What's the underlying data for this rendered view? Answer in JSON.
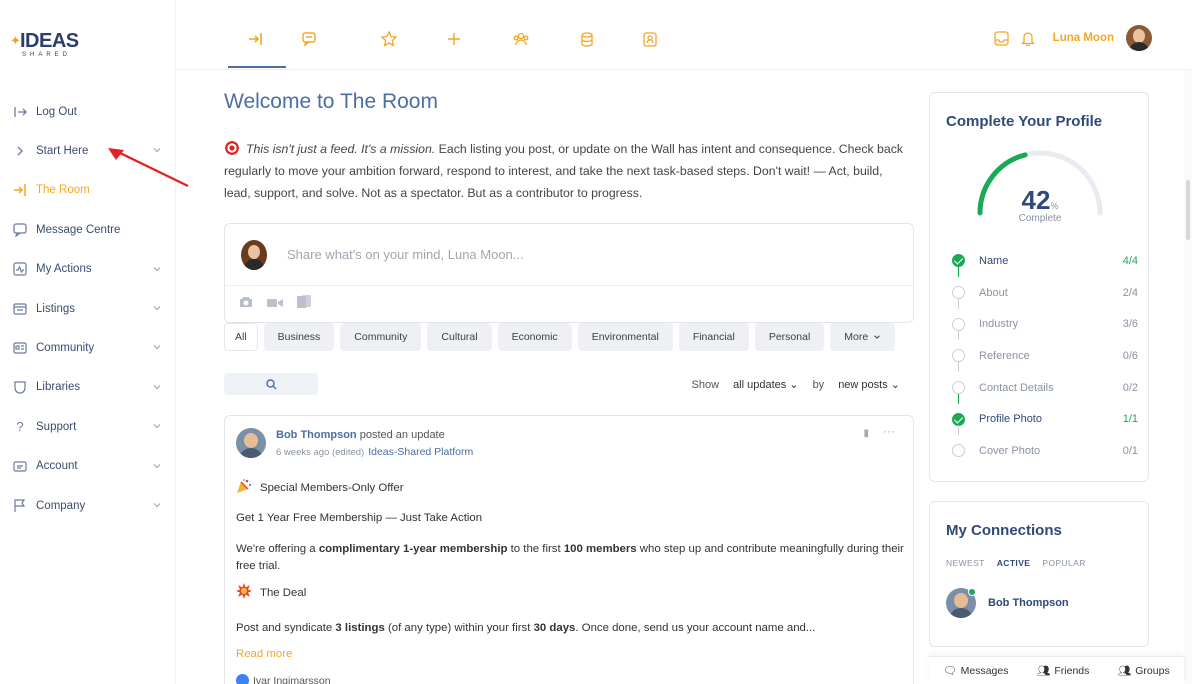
{
  "logo": {
    "text": "IDEAS",
    "sub": "SHARED"
  },
  "sidebar": {
    "items": [
      {
        "label": "Log Out",
        "icon": "logout-icon",
        "chevron": false
      },
      {
        "label": "Start Here",
        "icon": "chevron-right-icon",
        "chevron": true
      },
      {
        "label": "The Room",
        "icon": "enter-icon",
        "chevron": false,
        "active": true
      },
      {
        "label": "Message Centre",
        "icon": "chat-icon",
        "chevron": false
      },
      {
        "label": "My Actions",
        "icon": "activity-icon",
        "chevron": true
      },
      {
        "label": "Listings",
        "icon": "listings-icon",
        "chevron": true
      },
      {
        "label": "Community",
        "icon": "id-card-icon",
        "chevron": true
      },
      {
        "label": "Libraries",
        "icon": "library-icon",
        "chevron": true
      },
      {
        "label": "Support",
        "icon": "question-icon",
        "chevron": true
      },
      {
        "label": "Account",
        "icon": "account-icon",
        "chevron": true
      },
      {
        "label": "Company",
        "icon": "flag-icon",
        "chevron": true
      }
    ]
  },
  "topbar": {
    "icons": [
      "enter-icon",
      "chat-icon",
      "star-icon",
      "plus-icon",
      "community-icon",
      "database-icon",
      "contact-icon"
    ],
    "user_name": "Luna Moon"
  },
  "main": {
    "title": "Welcome to The Room",
    "intro_em": "This isn't just a feed. It's a mission.",
    "intro_rest": " Each listing you post, or update on the Wall has intent and consequence. Check back regularly to move your ambition forward, respond to interest, and take the next task-based steps. Don't wait! — Act, build, lead, support, and solve. Not as a spectator. But as a contributor to progress.",
    "composer_placeholder": "Share what's on your mind, Luna Moon...",
    "filters": [
      "All",
      "Business",
      "Community",
      "Cultural",
      "Economic",
      "Environmental",
      "Financial",
      "Personal",
      "More"
    ],
    "show_label": "Show",
    "show_value": "all updates",
    "by_label": "by",
    "by_value": "new posts"
  },
  "post": {
    "author": "Bob Thompson",
    "action": " posted an update",
    "time": "6 weeks ago (edited)",
    "group": "Ideas-Shared Platform",
    "heading1": "Special Members-Only Offer",
    "subheading": "Get 1 Year Free Membership — Just Take Action",
    "para1_a": "We're offering a ",
    "para1_b": "complimentary 1-year membership",
    "para1_c": " to the first ",
    "para1_d": "100 members",
    "para1_e": " who step up and contribute meaningfully during their free trial.",
    "heading2": "The Deal",
    "para2_a": "Post and syndicate ",
    "para2_b": "3 listings",
    "para2_c": " (of any type) within your first ",
    "para2_d": "30 days",
    "para2_e": ". Once done, send us your account name and...",
    "read_more": "Read more",
    "reactor": "Ivar Ingimarsson"
  },
  "profile": {
    "title": "Complete Your Profile",
    "percent": 42,
    "percent_sign": "%",
    "complete_label": "Complete",
    "steps": [
      {
        "label": "Name",
        "value": "4/4",
        "done": true
      },
      {
        "label": "About",
        "value": "2/4",
        "done": false
      },
      {
        "label": "Industry",
        "value": "3/6",
        "done": false
      },
      {
        "label": "Reference",
        "value": "0/6",
        "done": false
      },
      {
        "label": "Contact Details",
        "value": "0/2",
        "done": false
      },
      {
        "label": "Profile Photo",
        "value": "1/1",
        "done": true
      },
      {
        "label": "Cover Photo",
        "value": "0/1",
        "done": false
      }
    ]
  },
  "connections": {
    "title": "My Connections",
    "tabs": [
      "NEWEST",
      "ACTIVE",
      "POPULAR"
    ],
    "user": "Bob Thompson"
  },
  "bottombar": {
    "messages": "Messages",
    "friends": "Friends",
    "groups": "Groups"
  },
  "colors": {
    "accent": "#f5a623",
    "brand": "#2f4a7a",
    "link": "#4a6fa5",
    "success": "#1aaa55"
  }
}
